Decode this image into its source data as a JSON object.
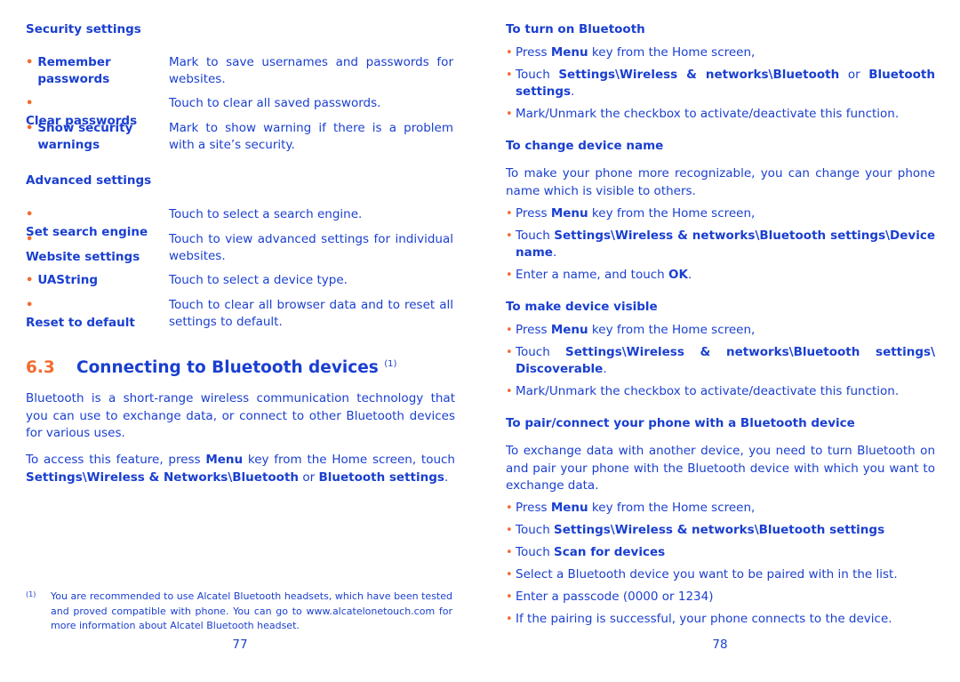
{
  "left_page": {
    "security": {
      "heading": "Security settings",
      "items": [
        {
          "term": "Remember passwords",
          "desc": "Mark to save usernames and passwords for websites."
        },
        {
          "term": "Clear passwords",
          "desc": "Touch to clear all saved passwords."
        },
        {
          "term": "Show security warnings",
          "desc": "Mark to show warning if there is a problem with a site’s security."
        }
      ]
    },
    "advanced": {
      "heading": "Advanced settings",
      "items": [
        {
          "term": "Set search engine",
          "desc": "Touch to select a search engine."
        },
        {
          "term": "Website settings",
          "desc": "Touch to view advanced settings for individual websites."
        },
        {
          "term": "UAString",
          "desc": "Touch to select a device type."
        },
        {
          "term": "Reset to default",
          "desc": "Touch to clear all browser data and to reset all settings to default."
        }
      ]
    },
    "section": {
      "number": "6.3",
      "title": "Connecting to Bluetooth devices",
      "footnote_ref": "(1)",
      "intro": "Bluetooth is a short-range wireless communication technology that you can use to exchange data, or connect to other Bluetooth devices for various uses.",
      "access": {
        "t1": "To access this feature, press ",
        "b1": "Menu",
        "t2": " key from the Home screen, touch ",
        "b2": "Settings\\Wireless & Networks\\Bluetooth",
        "t3": " or ",
        "b3": "Bluetooth settings",
        "t4": "."
      }
    },
    "footnote": {
      "mark": "(1)",
      "text": "You are recommended to use Alcatel Bluetooth headsets, which have been tested and proved compatible with phone. You can go to www.alcatelonetouch.com for more information about Alcatel Bluetooth headset."
    },
    "page_number": "77"
  },
  "right_page": {
    "turn_on": {
      "heading": "To turn on Bluetooth",
      "b1": {
        "t1": "Press ",
        "b1": "Menu",
        "t2": " key from the Home screen,"
      },
      "b2": {
        "t1": "Touch ",
        "b1": "Settings\\Wireless & networks\\Bluetooth",
        "t2": " or ",
        "b2": "Bluetooth settings",
        "t3": "."
      },
      "b3": "Mark/Unmark the checkbox to activate/deactivate this function."
    },
    "change_name": {
      "heading": "To change device name",
      "intro": "To make your phone more recognizable, you can change your phone name which is visible to others.",
      "b1": {
        "t1": "Press ",
        "b1": "Menu",
        "t2": " key from the Home screen,"
      },
      "b2": {
        "t1": "Touch ",
        "b1": "Settings\\Wireless & networks\\Bluetooth settings\\Device name",
        "t2": "."
      },
      "b3": {
        "t1": "Enter a name, and touch ",
        "b1": "OK",
        "t2": "."
      }
    },
    "visible": {
      "heading": "To make device visible",
      "b1": {
        "t1": "Press ",
        "b1": "Menu",
        "t2": " key from the Home screen,"
      },
      "b2": {
        "t1": "Touch ",
        "b1": "Settings\\Wireless & networks\\Bluetooth settings\\ Discoverable",
        "t2": "."
      },
      "b3": "Mark/Unmark the checkbox to activate/deactivate this function."
    },
    "pair": {
      "heading": "To pair/connect your phone with a Bluetooth device",
      "intro": "To exchange data with another device, you need to turn Bluetooth on and pair your phone with the Bluetooth device with which you want to exchange data.",
      "b1": {
        "t1": "Press ",
        "b1": "Menu",
        "t2": " key from the Home screen,"
      },
      "b2": {
        "t1": "Touch ",
        "b1": "Settings\\Wireless & networks\\Bluetooth settings"
      },
      "b3": {
        "t1": "Touch ",
        "b1": "Scan for devices"
      },
      "b4": "Select a Bluetooth device you want to be paired with in the list.",
      "b5": "Enter a passcode (0000 or 1234)",
      "b6": "If the pairing is successful, your phone connects to the device."
    },
    "page_number": "78"
  },
  "colors": {
    "text": "#1a3fd0",
    "accent": "#f26b2e"
  }
}
